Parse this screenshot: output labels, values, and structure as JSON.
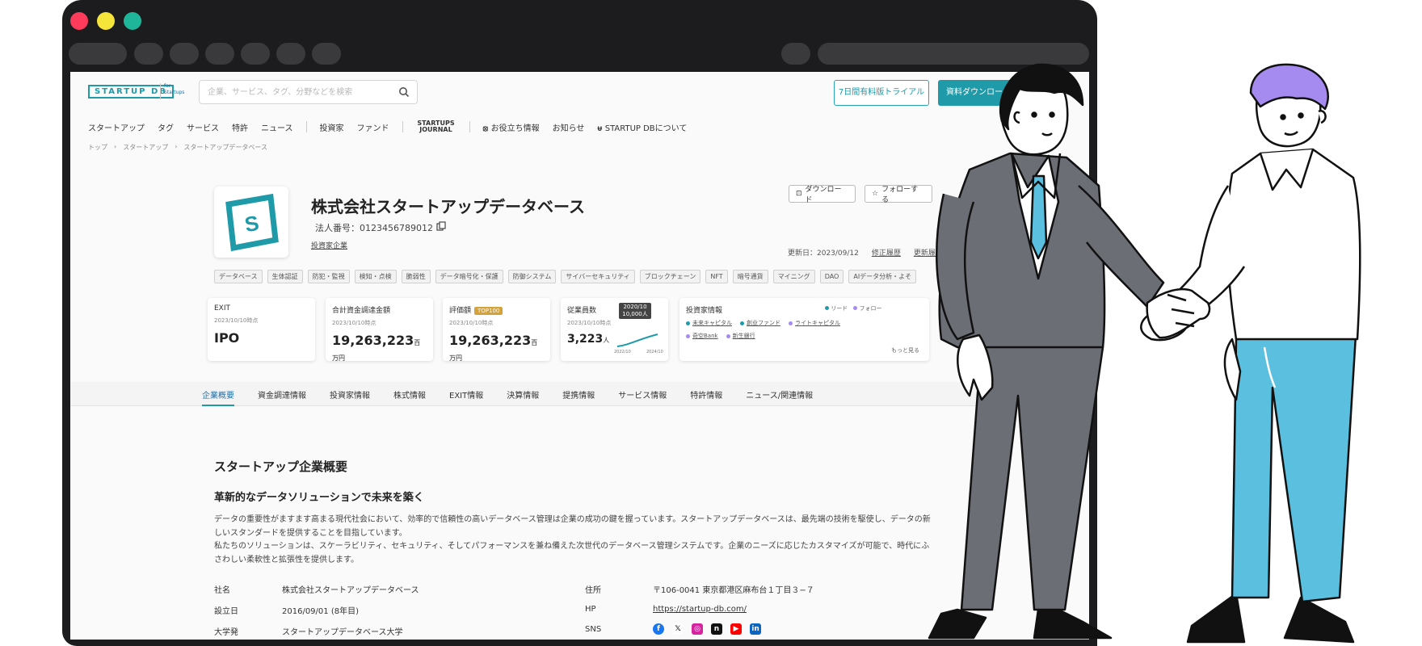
{
  "header": {
    "logo_text": "STARTUP DB",
    "logo_sub": "for Startups",
    "search_placeholder": "企業、サービス、タグ、分野などを検索",
    "trial_button": "7日間有料版トライアル",
    "download_button": "資料ダウンロード"
  },
  "nav": {
    "items": [
      "スタートアップ",
      "タグ",
      "サービス",
      "特許",
      "ニュース"
    ],
    "items2": [
      "投資家",
      "ファンド"
    ],
    "journal": "STARTUPS JOURNAL",
    "items3": [
      "お役立ち情報",
      "お知らせ",
      "STARTUP DBについて"
    ]
  },
  "breadcrumb": [
    "トップ",
    "›",
    "スタートアップ",
    "›",
    "スタートアップデータベース"
  ],
  "company": {
    "name": "株式会社スタートアップデータベース",
    "corp_number": "法人番号：0123456789012",
    "investor_link": "投資家企業",
    "download_btn": "ダウンロード",
    "follow_btn": "フォローする",
    "updated": "更新日：2023/09/12",
    "fix_history": "修正履歴",
    "update_history": "更新履歴"
  },
  "tags": [
    "データベース",
    "生体認証",
    "防犯・監視",
    "検知・点検",
    "脆弱性",
    "データ暗号化・保護",
    "防御システム",
    "サイバーセキュリティ",
    "ブロックチェーン",
    "NFT",
    "暗号通貨",
    "マイニング",
    "DAO",
    "AIデータ分析・よそ"
  ],
  "stats": {
    "exit": {
      "label": "EXIT",
      "date": "2023/10/10時点",
      "value": "IPO"
    },
    "funding": {
      "label": "合計資金調達金額",
      "date": "2023/10/10時点",
      "value": "19,263,223",
      "unit": "百万円"
    },
    "valuation": {
      "label": "評価額",
      "badge": "TOP100",
      "date": "2023/10/10時点",
      "value": "19,263,223",
      "unit": "百万円"
    },
    "employees": {
      "label": "従業員数",
      "date": "2023/10/10時点",
      "value": "3,223",
      "unit": "人",
      "tooltip_date": "2020/10",
      "tooltip_value": "10,000人",
      "axis_start": "2022/10",
      "axis_end": "2024/10"
    },
    "investors": {
      "label": "投資家情報",
      "legend_lead": "リード",
      "legend_follow": "フォロー",
      "list": [
        "未来キャピタル",
        "創业ファンド",
        "ライトキャピタル",
        "奇空Bank",
        "新生銀行"
      ],
      "more": "もっと見る"
    }
  },
  "tabs": [
    "企業概要",
    "資金調達情報",
    "投資家情報",
    "株式情報",
    "EXIT情報",
    "決算情報",
    "提携情報",
    "サービス情報",
    "特許情報",
    "ニュース/関連情報"
  ],
  "overview": {
    "title": "スタートアップ企業概要",
    "subtitle": "革新的なデータソリューションで未来を築く",
    "desc1": "データの重要性がますます高まる現代社会において、効率的で信頼性の高いデータベース管理は企業の成功の鍵を握っています。スタートアップデータベースは、最先端の技術を駆使し、データの新しいスタンダードを提供することを目指しています。",
    "desc2": "私たちのソリューションは、スケーラビリティ、セキュリティ、そしてパフォーマンスを兼ね備えた次世代のデータベース管理システムです。企業のニーズに応じたカスタマイズが可能で、時代にふさわしい柔軟性と拡張性を提供します。"
  },
  "info": {
    "name_label": "社名",
    "name_value": "株式会社スタートアップデータベース",
    "founded_label": "設立日",
    "founded_value": "2016/09/01 (8年目)",
    "univ_label": "大学発",
    "univ_value": "スタートアップデータベース大学",
    "address_label": "住所",
    "address_value": "〒106-0041 東京都港区麻布台１丁目３−７",
    "hp_label": "HP",
    "hp_value": "https://startup-db.com/",
    "sns_label": "SNS"
  },
  "colors": {
    "brand": "#1f9aa8",
    "accent_blue": "#5bbfdf",
    "suit_gray": "#6b6e74",
    "hair_purple": "#a58bf0"
  }
}
